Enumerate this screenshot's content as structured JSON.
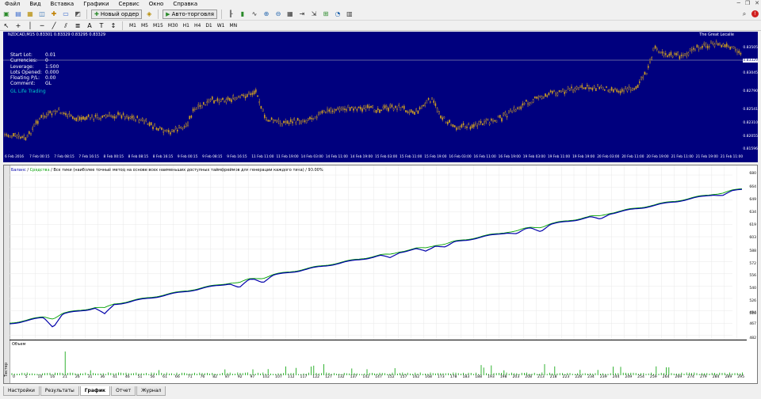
{
  "menu": [
    "Файл",
    "Вид",
    "Вставка",
    "Графики",
    "Сервис",
    "Окно",
    "Справка"
  ],
  "toolbar": {
    "new_order": "Новый ордер",
    "auto_trading": "Авто-торговля",
    "timeframes": [
      "M1",
      "M5",
      "M15",
      "M30",
      "H1",
      "H4",
      "D1",
      "W1",
      "MN"
    ]
  },
  "chart": {
    "symbol_line": "NZDCAD,M15  0.83301 0.83329 0.83295 0.83329",
    "corner_label": "The Great Lecalle",
    "info": [
      {
        "k": "Start Lot:",
        "v": "0.01"
      },
      {
        "k": "Currencies:",
        "v": "0"
      },
      {
        "k": "Leverage:",
        "v": "1:500"
      },
      {
        "k": "Lots Opened:",
        "v": "0.000"
      },
      {
        "k": "Floating P/L:",
        "v": "0.00"
      },
      {
        "k": "Comment:",
        "v": "GL"
      }
    ],
    "brand": "GL Life Trading",
    "price_labels": [
      "0.83505",
      "0.83329",
      "0.83045",
      "0.82790",
      "0.82541",
      "0.82310",
      "0.82055",
      "0.81596"
    ],
    "time_labels": [
      "6 Feb 2016",
      "7 Feb 00:15",
      "7 Feb 08:15",
      "7 Feb 16:15",
      "8 Feb 00:15",
      "8 Feb 08:15",
      "8 Feb 16:15",
      "9 Feb 00:15",
      "9 Feb 08:15",
      "9 Feb 16:15",
      "11 Feb 11:00",
      "11 Feb 19:00",
      "14 Feb 03:00",
      "14 Feb 11:00",
      "14 Feb 19:00",
      "15 Feb 03:00",
      "15 Feb 11:00",
      "15 Feb 19:00",
      "16 Feb 03:00",
      "16 Feb 11:00",
      "16 Feb 19:00",
      "19 Feb 03:00",
      "19 Feb 11:00",
      "19 Feb 19:00",
      "20 Feb 03:00",
      "20 Feb 11:00",
      "20 Feb 19:00",
      "21 Feb 11:00",
      "21 Feb 19:00",
      "21 Feb 11:00"
    ],
    "colors": {
      "bg": "#00007e",
      "candle": "#d0a020",
      "grid": "#ffffff"
    }
  },
  "tester": {
    "legend_balance": "Баланс",
    "legend_sep1": " / ",
    "legend_equity": "Средства",
    "legend_rest": " / Все тики (наиболее точный метод на основе всех наименьших доступных таймфреймов для генерации каждого тика) / 90.00%",
    "y_labels": [
      "680",
      "664",
      "649",
      "634",
      "619",
      "603",
      "588",
      "572",
      "556",
      "540",
      "526",
      "510",
      "494",
      "467",
      "482"
    ],
    "volume_label": "Объем",
    "vertical_tab": "Тестер",
    "x_labels": [
      "0",
      "5",
      "10",
      "16",
      "21",
      "26",
      "31",
      "36",
      "41",
      "46",
      "51",
      "56",
      "61",
      "66",
      "71",
      "76",
      "82",
      "87",
      "92",
      "97",
      "102",
      "107",
      "112",
      "117",
      "122",
      "127",
      "132",
      "137",
      "142",
      "147",
      "152",
      "157",
      "162",
      "168",
      "173",
      "178",
      "183",
      "188",
      "193",
      "198",
      "203",
      "208",
      "213",
      "218",
      "223",
      "228",
      "234",
      "239",
      "244",
      "249",
      "254",
      "259",
      "264",
      "269",
      "274",
      "279",
      "284",
      "289",
      "295"
    ],
    "colors": {
      "balance": "#0000aa",
      "equity": "#00a000",
      "volume": "#00a000"
    }
  },
  "tabs": [
    "Настройки",
    "Результаты",
    "График",
    "Отчет",
    "Журнал"
  ],
  "active_tab": "График"
}
